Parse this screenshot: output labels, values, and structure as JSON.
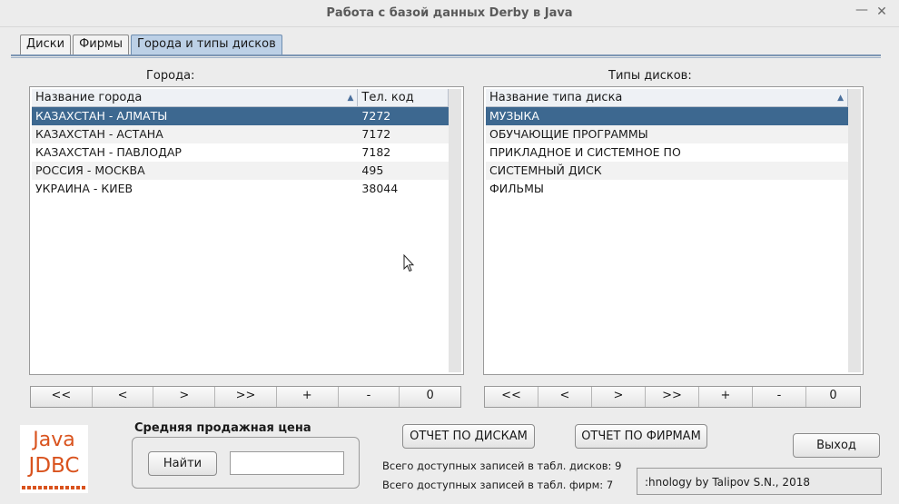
{
  "window": {
    "title": "Работа с базой данных Derby в Java",
    "minimize_icon": "—",
    "close_icon": "✕"
  },
  "tabs": [
    {
      "label": "Диски",
      "active": false
    },
    {
      "label": "Фирмы",
      "active": false
    },
    {
      "label": "Города и типы дисков",
      "active": true
    }
  ],
  "cities": {
    "label": "Города:",
    "columns": [
      "Название города",
      "Тел. код"
    ],
    "sort_icon": "▲",
    "rows": [
      {
        "name": "КАЗАХСТАН - АЛМАТЫ",
        "code": "7272"
      },
      {
        "name": "КАЗАХСТАН - АСТАНА",
        "code": "7172"
      },
      {
        "name": "КАЗАХСТАН - ПАВЛОДАР",
        "code": "7182"
      },
      {
        "name": "РОССИЯ - МОСКВА",
        "code": "495"
      },
      {
        "name": "УКРАИНА - КИЕВ",
        "code": "38044"
      }
    ],
    "nav": [
      "<<",
      "<",
      ">",
      ">>",
      "+",
      "-",
      "0"
    ]
  },
  "disk_types": {
    "label": "Типы дисков:",
    "columns": [
      "Название типа диска"
    ],
    "sort_icon": "▲",
    "rows": [
      "МУЗЫКА",
      "ОБУЧАЮЩИЕ ПРОГРАММЫ",
      "ПРИКЛАДНОЕ И СИСТЕМНОЕ ПО",
      "СИСТЕМНЫЙ ДИСК",
      "ФИЛЬМЫ"
    ],
    "nav": [
      "<<",
      "<",
      ">",
      ">>",
      "+",
      "-",
      "0"
    ]
  },
  "logo": {
    "line1": "Java",
    "line2": "JDBC"
  },
  "avg_price": {
    "title": "Средняя продажная цена",
    "find_button": "Найти",
    "value": ""
  },
  "buttons": {
    "disk_report": "ОТЧЕТ ПО ДИСКАМ",
    "firm_report": "ОТЧЕТ ПО ФИРМАМ",
    "exit": "Выход"
  },
  "stats": {
    "disks": "Всего доступных записей в табл. дисков: 9",
    "firms": "Всего доступных записей в табл. фирм: 7"
  },
  "credit": ":hnology by Talipov S.N., 2018"
}
